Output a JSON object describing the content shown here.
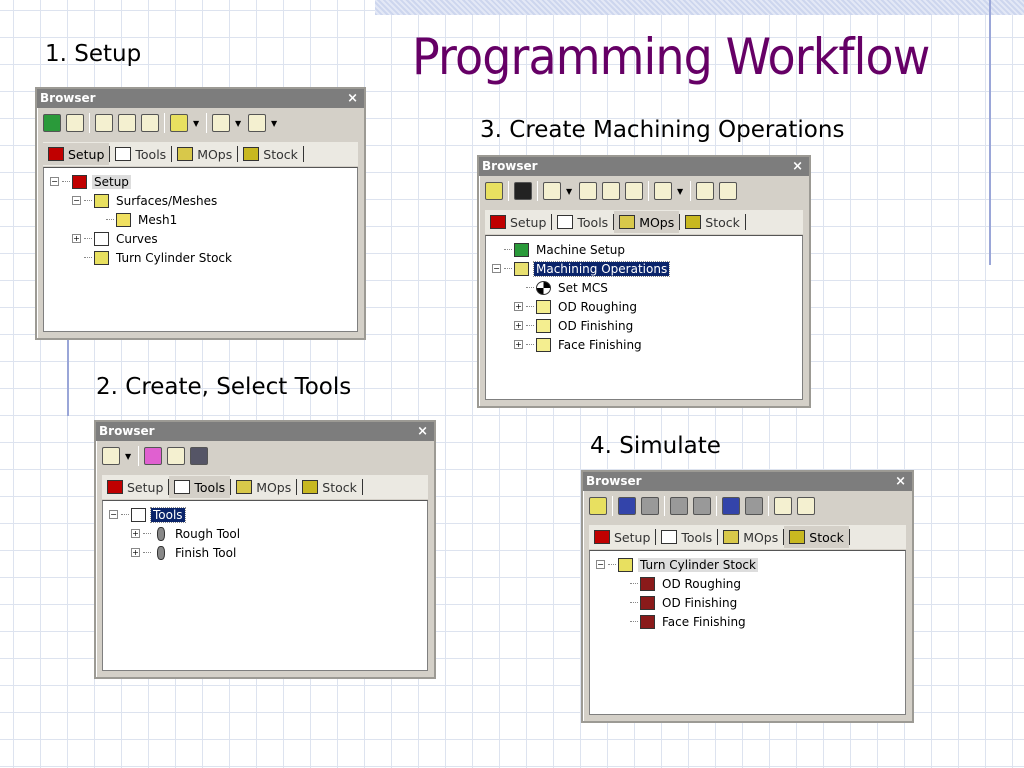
{
  "title": "Programming Workflow",
  "steps": [
    "1. Setup",
    "2. Create, Select Tools",
    "3. Create Machining Operations",
    "4. Simulate"
  ],
  "colors": {
    "title": "#660066",
    "titlebar": "#7d7d7d",
    "selection": "#0a246a"
  },
  "panels": [
    {
      "title": "Browser",
      "close": "×",
      "active_tab": 0,
      "toolbar": [
        "machine-icon",
        "document-icon",
        "sep",
        "xyz-axes-icon",
        "move-icon",
        "region-icon",
        "sep",
        "stock-box-icon",
        "dropdown",
        "sep",
        "fixture-icon",
        "dropdown",
        "tools-hammer-icon",
        "dropdown"
      ],
      "tabs": [
        "Setup",
        "Tools",
        "MOps",
        "Stock"
      ],
      "tree": [
        {
          "level": 0,
          "exp": "-",
          "icon": "setup",
          "label": "Setup",
          "state": "hl"
        },
        {
          "level": 1,
          "exp": "-",
          "icon": "part",
          "label": "Surfaces/Meshes"
        },
        {
          "level": 2,
          "exp": "",
          "icon": "mesh",
          "label": "Mesh1"
        },
        {
          "level": 1,
          "exp": "+",
          "icon": "curve",
          "label": "Curves"
        },
        {
          "level": 1,
          "exp": "",
          "icon": "stock",
          "label": "Turn Cylinder Stock"
        }
      ]
    },
    {
      "title": "Browser",
      "close": "×",
      "active_tab": 1,
      "toolbar": [
        "tool-icon",
        "dropdown",
        "sep",
        "tool-library-icon",
        "copy-tool-icon",
        "save-icon"
      ],
      "tabs": [
        "Setup",
        "Tools",
        "MOps",
        "Stock"
      ],
      "tree": [
        {
          "level": 0,
          "exp": "-",
          "icon": "tools",
          "label": "Tools",
          "state": "sel"
        },
        {
          "level": 1,
          "exp": "+",
          "icon": "insert",
          "label": "Rough Tool"
        },
        {
          "level": 1,
          "exp": "+",
          "icon": "insert",
          "label": "Finish Tool"
        }
      ]
    },
    {
      "title": "Browser",
      "close": "×",
      "active_tab": 2,
      "toolbar": [
        "stock-box-icon",
        "sep",
        "mcs-icon",
        "sep",
        "tool-icon",
        "dropdown",
        "tool-move-icon",
        "tool-offset-icon",
        "path-icon",
        "sep",
        "operation-icon",
        "dropdown",
        "sep",
        "report-icon",
        "post-icon"
      ],
      "tabs": [
        "Setup",
        "Tools",
        "MOps",
        "Stock"
      ],
      "tree": [
        {
          "level": 0,
          "exp": "",
          "icon": "machine",
          "label": "Machine Setup"
        },
        {
          "level": 0,
          "exp": "-",
          "icon": "folder-open",
          "label": "Machining Operations",
          "state": "sel"
        },
        {
          "level": 1,
          "exp": "",
          "icon": "mcs",
          "label": "Set MCS"
        },
        {
          "level": 1,
          "exp": "+",
          "icon": "folder",
          "label": "OD Roughing"
        },
        {
          "level": 1,
          "exp": "+",
          "icon": "folder",
          "label": "OD Finishing"
        },
        {
          "level": 1,
          "exp": "+",
          "icon": "folder",
          "label": "Face Finishing"
        }
      ]
    },
    {
      "title": "Browser",
      "close": "×",
      "active_tab": 3,
      "toolbar": [
        "stock-box-icon",
        "sep",
        "play-icon",
        "pause-icon",
        "sep",
        "step-icon",
        "step-end-icon",
        "sep",
        "fast-forward-icon",
        "rewind-icon",
        "sep",
        "compare-icon",
        "report-icon"
      ],
      "tabs": [
        "Setup",
        "Tools",
        "MOps",
        "Stock"
      ],
      "tree": [
        {
          "level": 0,
          "exp": "-",
          "icon": "stock",
          "label": "Turn Cylinder Stock",
          "state": "hl"
        },
        {
          "level": 1,
          "exp": "",
          "icon": "simop",
          "label": "OD Roughing"
        },
        {
          "level": 1,
          "exp": "",
          "icon": "simop",
          "label": "OD Finishing"
        },
        {
          "level": 1,
          "exp": "",
          "icon": "simop",
          "label": "Face Finishing"
        }
      ]
    }
  ]
}
